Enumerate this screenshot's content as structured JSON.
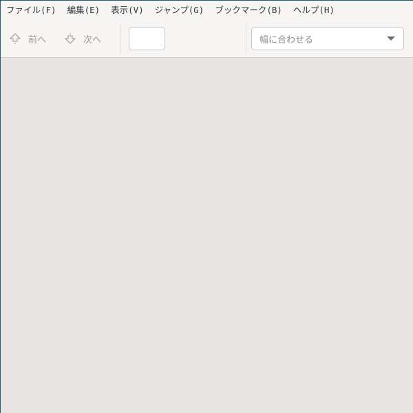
{
  "menubar": {
    "items": [
      {
        "label": "ファイル(F)"
      },
      {
        "label": "編集(E)"
      },
      {
        "label": "表示(V)"
      },
      {
        "label": "ジャンプ(G)"
      },
      {
        "label": "ブックマーク(B)"
      },
      {
        "label": "ヘルプ(H)"
      }
    ]
  },
  "toolbar": {
    "prev_label": "前へ",
    "next_label": "次へ",
    "page_entry_value": "",
    "zoom_value": "幅に合わせる"
  },
  "icons": {
    "prev": "go-up-icon",
    "next": "go-down-icon",
    "zoom_dropdown": "chevron-down-icon"
  },
  "colors": {
    "menubar_bg": "#f6f5f4",
    "toolbar_bg": "#f6f5f4",
    "document_bg": "#e8e4e1",
    "disabled_text": "#9a9996",
    "window_frame": "#1f5e74"
  }
}
